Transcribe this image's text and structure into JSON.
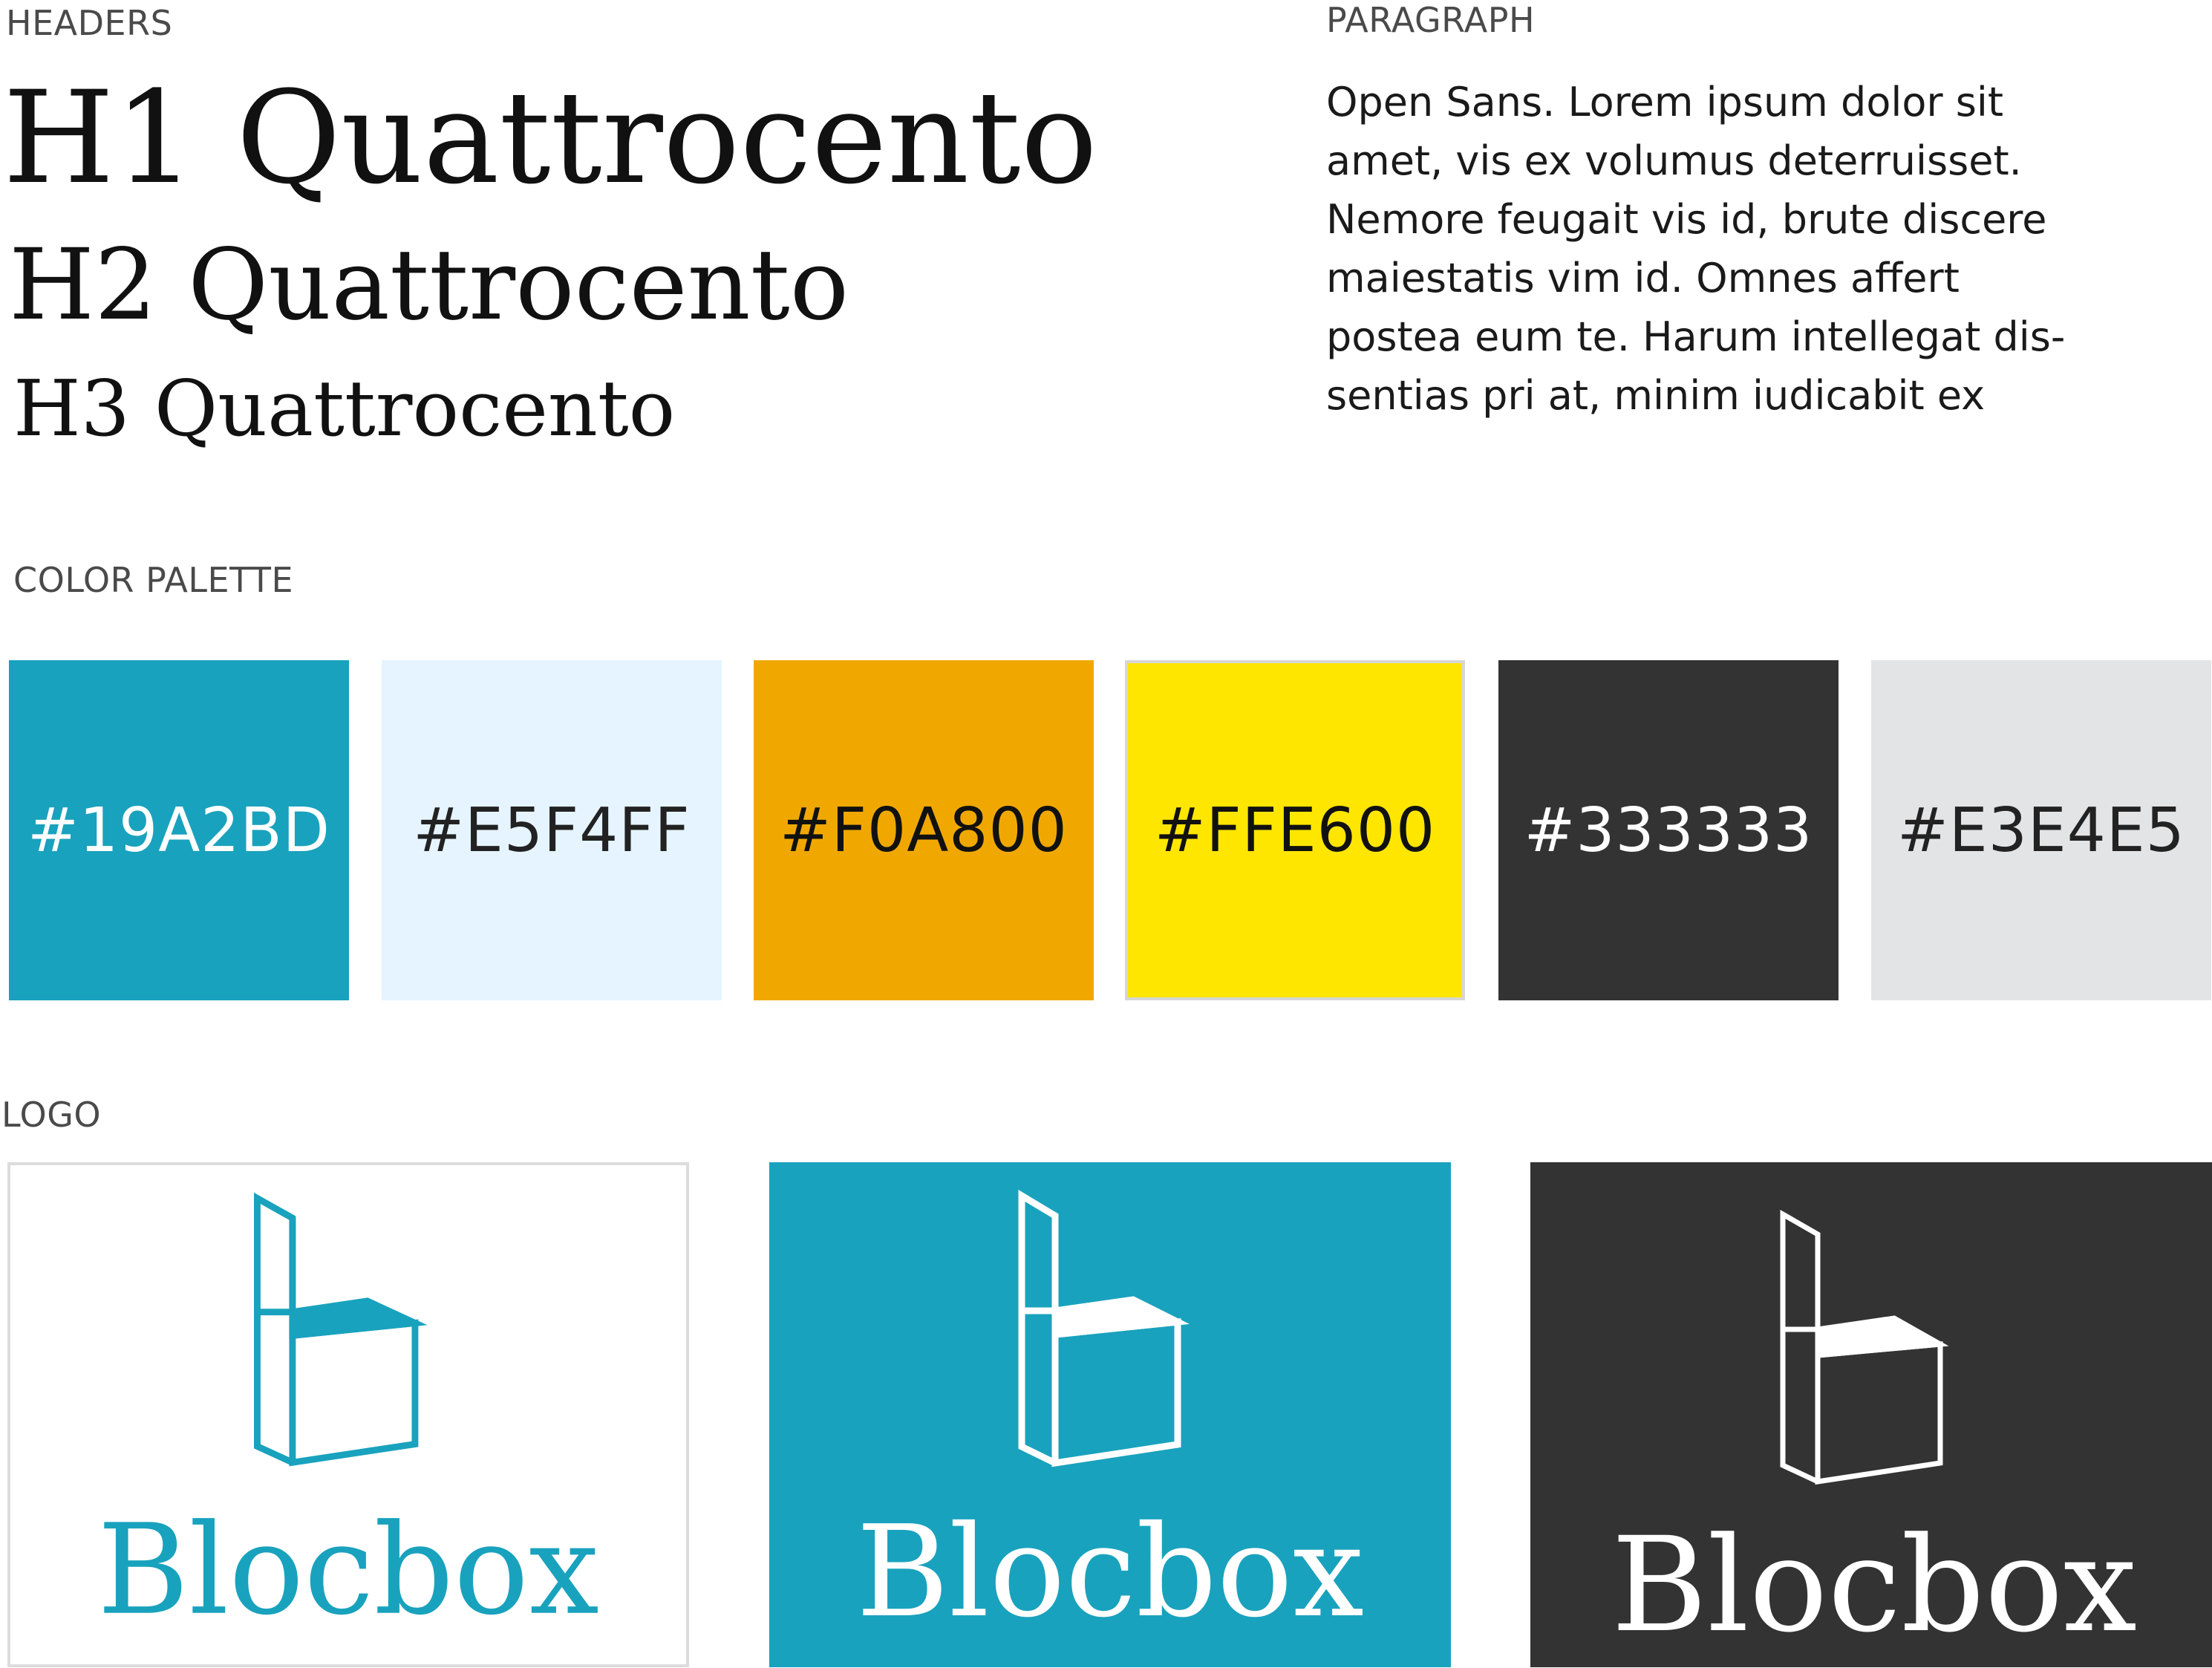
{
  "headers": {
    "label": "HEADERS",
    "h1": "H1 Quattrocento",
    "h2": "H2 Quattrocento",
    "h3": "H3 Quattrocento"
  },
  "paragraph": {
    "label": "PARAGRAPH",
    "lines": [
      "Open Sans. Lorem ipsum dolor sit",
      "amet, vis ex volumus deterruisset.",
      "Nemore feugait vis id, brute discere",
      "maiestatis vim id. Omnes affert",
      "postea eum te. Harum intellegat dis-",
      "sentias pri at, minim iudicabit ex"
    ]
  },
  "palette": {
    "label": "COLOR PALETTE",
    "swatches": [
      {
        "label": "#19A2BD",
        "color": "#19A2BD",
        "text_color": "#ffffff"
      },
      {
        "label": "#E5F4FF",
        "color": "#E5F4FF",
        "text_color": "#222222"
      },
      {
        "label": "#F0A800",
        "color": "#F0A800",
        "text_color": "#111111"
      },
      {
        "label": "#FFE600",
        "color": "#FFE600",
        "text_color": "#111111"
      },
      {
        "label": "#333333",
        "color": "#333333",
        "text_color": "#ffffff"
      },
      {
        "label": "#E3E4E5",
        "color": "#E3E4E5",
        "text_color": "#222222"
      }
    ]
  },
  "logo": {
    "label": "LOGO",
    "wordmark": "Blocbox",
    "variants": [
      {
        "background": "#ffffff",
        "foreground": "#19A2BD",
        "border": "#dcdcdc"
      },
      {
        "background": "#19A2BD",
        "foreground": "#ffffff",
        "border": "none"
      },
      {
        "background": "#333333",
        "foreground": "#ffffff",
        "border": "none"
      }
    ]
  }
}
